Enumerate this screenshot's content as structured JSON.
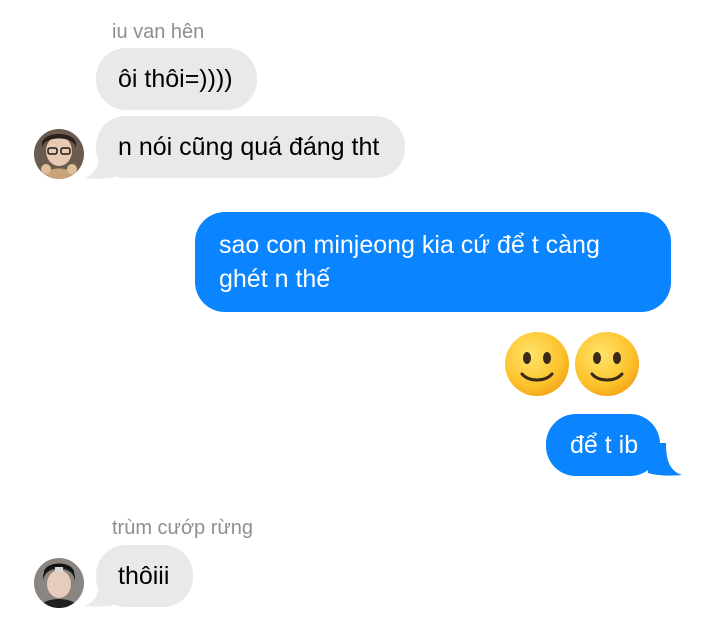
{
  "thread": {
    "groups": [
      {
        "sender": "iu van hên",
        "messages": [
          "ôi thôi=))))",
          "n nói cũng quá đáng tht"
        ]
      },
      {
        "sender": "me",
        "messages": [
          "sao con minjeong kia cứ để t càng",
          "ghét n thế",
          "để t ib"
        ],
        "emoji": [
          "slightly-smiling-face",
          "slightly-smiling-face"
        ]
      },
      {
        "sender": "trùm cướp rừng",
        "messages": [
          "thôiii"
        ]
      }
    ]
  },
  "colors": {
    "incoming_bubble": "#e9e9eb",
    "outgoing_bubble": "#0a84ff",
    "sender_name": "#8e8e93"
  }
}
